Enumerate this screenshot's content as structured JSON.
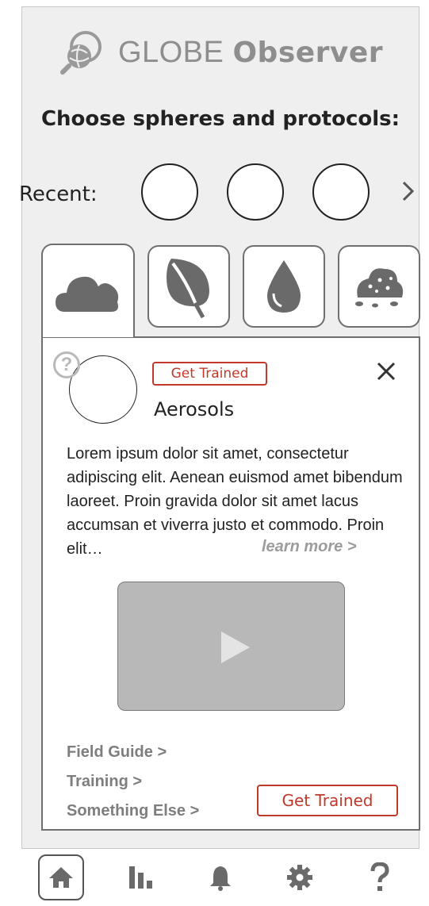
{
  "app": {
    "logo_prefix": "GLOBE",
    "logo_name": "Observer",
    "logo_icon": "globe-magnifier-icon"
  },
  "heading": "Choose spheres and protocols:",
  "recent": {
    "label": "Recent:",
    "slots": 3,
    "next_icon": "chevron-right-icon"
  },
  "spheres": [
    {
      "name": "atmosphere",
      "icon": "cloud-icon",
      "active": true
    },
    {
      "name": "biosphere",
      "icon": "leaf-icon",
      "active": false
    },
    {
      "name": "hydrosphere",
      "icon": "water-drop-icon",
      "active": false
    },
    {
      "name": "pedosphere",
      "icon": "soil-icon",
      "active": false
    }
  ],
  "protocol": {
    "get_trained_badge": "Get Trained",
    "title": "Aerosols",
    "description": "Lorem ipsum dolor sit amet, consectetur adipiscing elit. Aenean euismod amet bibendum laoreet. Proin gravida dolor sit amet lacus accumsan et viverra justo et commodo. Proin elit…",
    "learn_more": "learn more  >",
    "links": {
      "field_guide": "Field Guide  >",
      "training": "Training  >",
      "something_else": "Something Else  >"
    },
    "get_trained_button": "Get Trained"
  },
  "nav": [
    {
      "name": "home",
      "icon": "home-icon",
      "active": true
    },
    {
      "name": "stats",
      "icon": "bar-chart-icon",
      "active": false
    },
    {
      "name": "notifications",
      "icon": "bell-icon",
      "active": false
    },
    {
      "name": "settings",
      "icon": "gear-icon",
      "active": false
    },
    {
      "name": "help",
      "icon": "help-icon",
      "active": false
    }
  ],
  "colors": {
    "background": "#efefef",
    "accent_red": "#c0392b",
    "icon_gray": "#6a6a6a",
    "muted_text": "#7e7e7e"
  }
}
